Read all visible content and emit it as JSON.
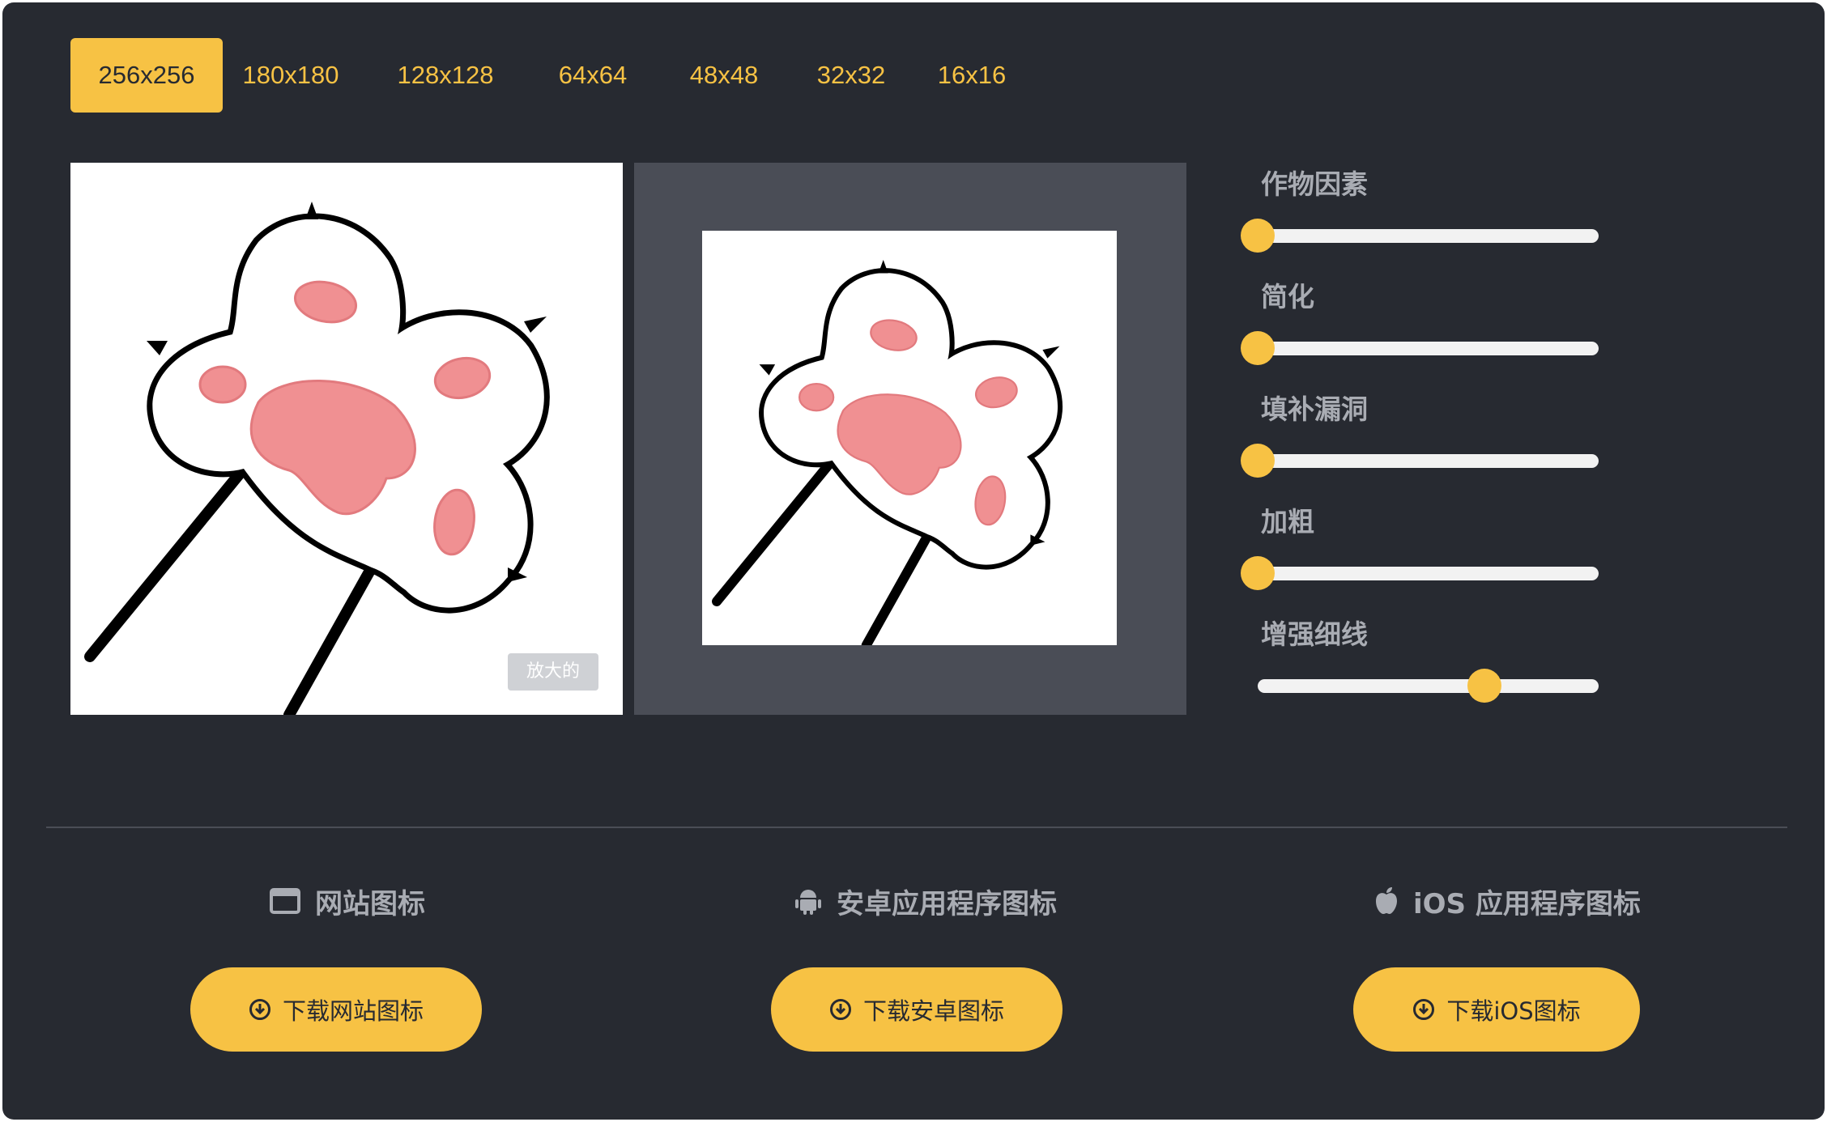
{
  "tabs": [
    {
      "label": "256x256",
      "active": true
    },
    {
      "label": "180x180"
    },
    {
      "label": "128x128"
    },
    {
      "label": "64x64"
    },
    {
      "label": "48x48"
    },
    {
      "label": "32x32"
    },
    {
      "label": "16x16"
    }
  ],
  "preview": {
    "zoom_badge": "放大的"
  },
  "controls": [
    {
      "label": "作物因素",
      "value": 0
    },
    {
      "label": "简化",
      "value": 0
    },
    {
      "label": "填补漏洞",
      "value": 0
    },
    {
      "label": "加粗",
      "value": 0
    },
    {
      "label": "增强细线",
      "value": 0.7
    }
  ],
  "sections": [
    {
      "title": "网站图标",
      "icon": "browser-window-icon",
      "button_label": "下载网站图标"
    },
    {
      "title": "安卓应用程序图标",
      "icon": "android-icon",
      "button_label": "下载安卓图标"
    },
    {
      "title": "iOS 应用程序图标",
      "icon": "apple-icon",
      "button_label": "下载iOS图标"
    }
  ],
  "colors": {
    "background": "#272a31",
    "accent": "#f7c244",
    "label": "#a9acb3",
    "panel": "#4a4d56"
  }
}
